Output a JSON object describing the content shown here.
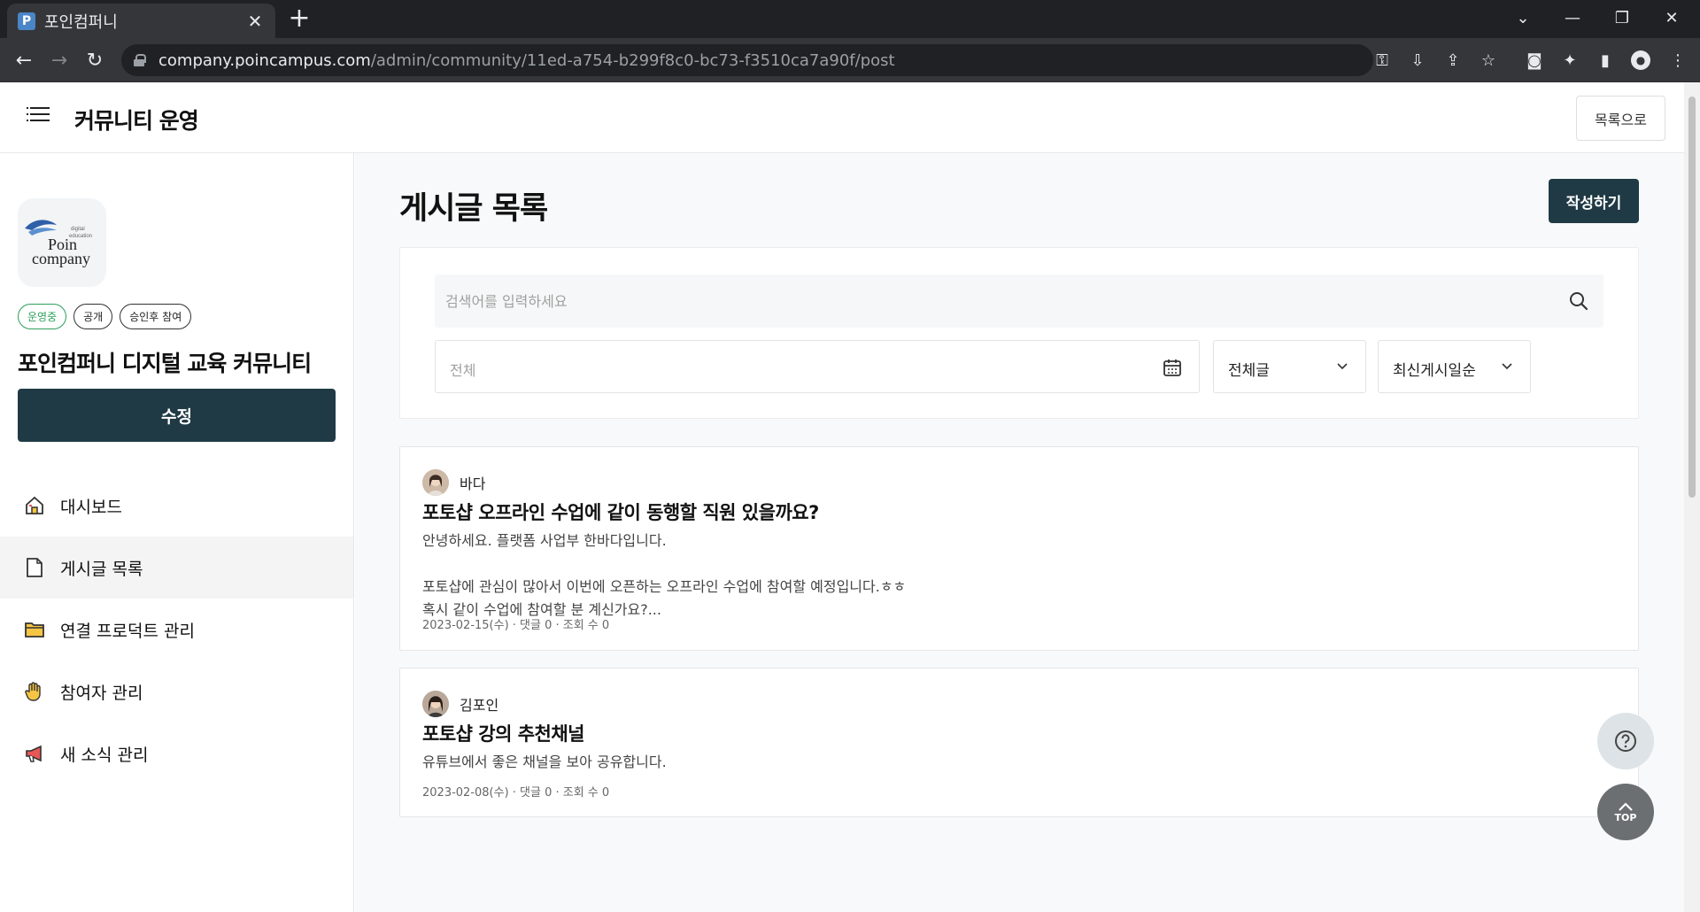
{
  "browser": {
    "tab_title": "포인컴퍼니",
    "favicon_letter": "P",
    "url_host": "company.poincampus.com",
    "url_path": "/admin/community/11ed-a754-b299f8c0-bc73-f3510ca7a90f/post"
  },
  "header": {
    "title": "커뮤니티 운영",
    "back_button": "목록으로"
  },
  "sidebar": {
    "logo_text_line1": "Poin",
    "logo_text_line2": "company",
    "logo_small_1": "digital",
    "logo_small_2": "education",
    "badges": [
      "운영중",
      "공개",
      "승인후 참여"
    ],
    "community_name": "포인컴퍼니 디지털 교육 커뮤니티",
    "edit_button": "수정",
    "nav": [
      {
        "label": "대시보드",
        "icon": "house-icon"
      },
      {
        "label": "게시글 목록",
        "icon": "document-icon",
        "active": true
      },
      {
        "label": "연결 프로덕트 관리",
        "icon": "folder-icon"
      },
      {
        "label": "참여자 관리",
        "icon": "hand-icon"
      },
      {
        "label": "새 소식 관리",
        "icon": "megaphone-icon"
      }
    ]
  },
  "main": {
    "page_title": "게시글 목록",
    "write_button": "작성하기",
    "search": {
      "placeholder": "검색어를 입력하세요",
      "value": ""
    },
    "date_filter": "전체",
    "type_select": "전체글",
    "sort_select": "최신게시일순",
    "posts": [
      {
        "author": "바다",
        "title": "포토샵 오프라인 수업에 같이 동행할 직원 있을까요?",
        "body": "안녕하세요. 플랫폼 사업부 한바다입니다.\n\n포토샵에 관심이 많아서 이번에 오픈하는 오프라인 수업에 참여할 예정입니다.ㅎㅎ\n혹시 같이 수업에 참여할 분 계신가요?...",
        "meta": "2023-02-15(수) · 댓글 0 · 조회 수 0"
      },
      {
        "author": "김포인",
        "title": "포토샵 강의 추천채널",
        "body": "유튜브에서 좋은 채널을 보아 공유합니다.",
        "meta": "2023-02-08(수) · 댓글 0 · 조회 수 0"
      }
    ]
  },
  "floating": {
    "top_label": "TOP"
  },
  "colors": {
    "primary": "#1f3a44",
    "badge_green": "#2e9e5b",
    "chrome_dark": "#202124"
  }
}
